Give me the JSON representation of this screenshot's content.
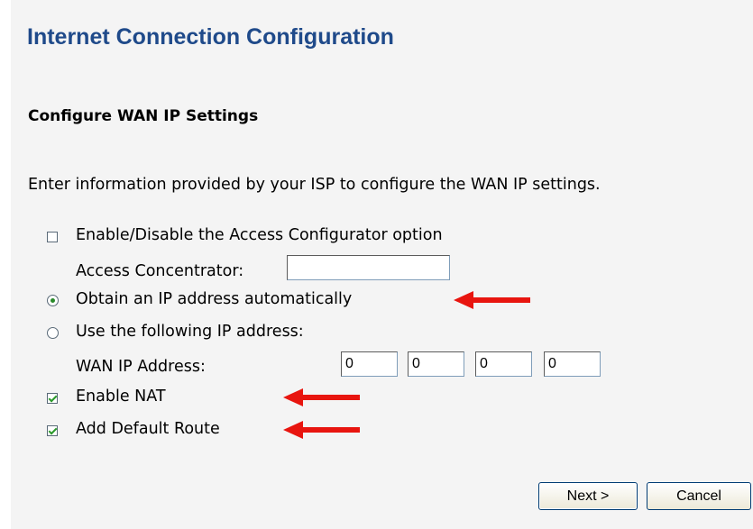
{
  "page": {
    "title": "Internet Connection Configuration",
    "subtitle": "Configure WAN IP Settings",
    "intro": "Enter information provided by your ISP to configure the WAN IP settings."
  },
  "options": {
    "access_configurator": {
      "label": "Enable/Disable the Access Configurator option",
      "checked": false
    },
    "access_concentrator": {
      "label": "Access Concentrator:",
      "value": ""
    },
    "obtain_auto": {
      "label": "Obtain an IP address automatically",
      "selected": true
    },
    "use_following": {
      "label": "Use the following IP address:",
      "selected": false
    },
    "wan_ip": {
      "label": "WAN IP Address:",
      "octets": [
        "0",
        "0",
        "0",
        "0"
      ]
    },
    "enable_nat": {
      "label": "Enable NAT",
      "checked": true
    },
    "default_route": {
      "label": "Add Default Route",
      "checked": true
    }
  },
  "buttons": {
    "next": "Next >",
    "cancel": "Cancel"
  },
  "colors": {
    "title": "#1f4a8a",
    "arrow": "#e8150f",
    "panel": "#f4f4f4"
  }
}
